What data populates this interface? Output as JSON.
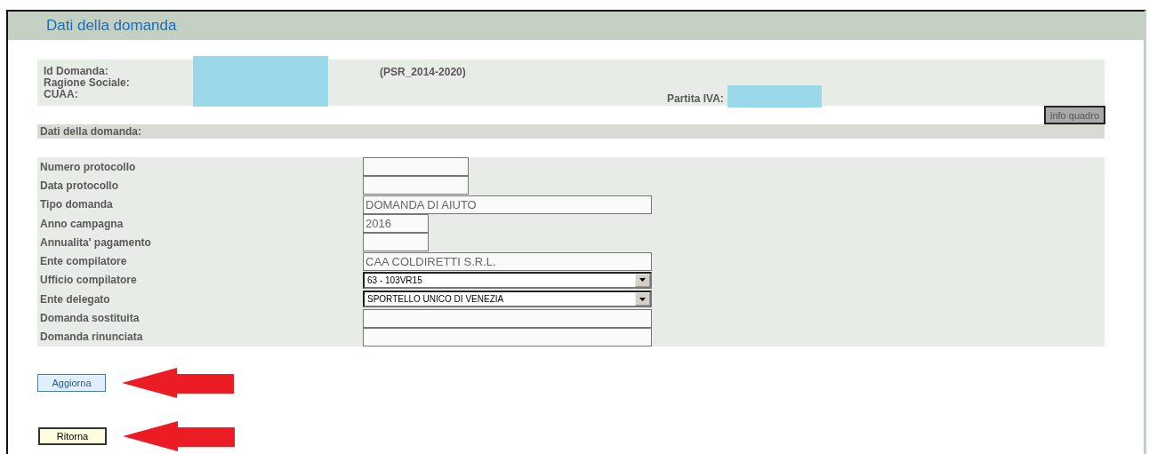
{
  "page": {
    "title": "Dati della domanda"
  },
  "summary": {
    "labels": [
      "Id Domanda:",
      "Ragione Sociale:",
      "CUAA:"
    ],
    "scheme": "(PSR_2014-2020)",
    "vat_label": "Partita IVA:",
    "info_button": "info quadro"
  },
  "section": {
    "title": "Dati della domanda:"
  },
  "form": [
    {
      "label": "Numero protocollo",
      "kind": "text"
    },
    {
      "label": "Data protocollo",
      "kind": "text"
    },
    {
      "label": "Tipo domanda",
      "kind": "text",
      "value": "DOMANDA DI AIUTO"
    },
    {
      "label": "Anno campagna",
      "kind": "text",
      "value": "2016"
    },
    {
      "label": "Annualita' pagamento",
      "kind": "text"
    },
    {
      "label": "Ente compilatore",
      "kind": "text",
      "value": "CAA COLDIRETTI S.R.L."
    },
    {
      "label": "Ufficio compilatore",
      "kind": "select",
      "value": "63 - 103VR15"
    },
    {
      "label": "Ente delegato",
      "kind": "select",
      "value": "SPORTELLO UNICO DI VENEZIA"
    },
    {
      "label": "Domanda sostituita",
      "kind": "text"
    },
    {
      "label": "Domanda rinunciata",
      "kind": "text"
    }
  ],
  "buttons": [
    {
      "label": "Aggiorna",
      "kind": "primary"
    },
    {
      "label": "Ritorna",
      "kind": "back"
    }
  ]
}
